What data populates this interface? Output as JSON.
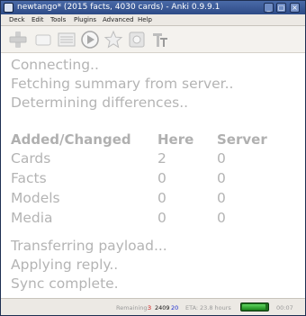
{
  "window": {
    "title": "newtango* (2015 facts, 4030 cards) - Anki 0.9.9.1",
    "minimize": "_",
    "maximize": "▢",
    "close": "×"
  },
  "menubar": {
    "items": [
      "Deck",
      "Edit",
      "Tools",
      "Plugins",
      "Advanced",
      "Help"
    ]
  },
  "toolbar": {
    "buttons": [
      "add-cards",
      "blank-card",
      "browse-list",
      "play-review",
      "star",
      "sync",
      "text-format"
    ]
  },
  "sync": {
    "lines_top": [
      "Connecting..",
      "Fetching summary from server..",
      "Determining differences.."
    ],
    "table": {
      "headers": [
        "Added/Changed",
        "Here",
        "Server"
      ],
      "rows": [
        {
          "label": "Cards",
          "here": "2",
          "server": "0"
        },
        {
          "label": "Facts",
          "here": "0",
          "server": "0"
        },
        {
          "label": "Models",
          "here": "0",
          "server": "0"
        },
        {
          "label": "Media",
          "here": "0",
          "server": "0"
        }
      ]
    },
    "lines_bottom": [
      "Transferring payload...",
      "Applying reply..",
      "Sync complete."
    ]
  },
  "statusbar": {
    "remaining_label": "Remaining:",
    "remaining_red": "3",
    "remaining_new": "2409",
    "remaining_blue": "20",
    "eta_label": "ETA:",
    "eta_value": "23.8 hours",
    "progress_fraction": 0.92,
    "timer": "00:07"
  },
  "colors": {
    "content_text": "#b4b4b4",
    "red": "#d21010",
    "blue": "#1a2ad0",
    "progress": "#2fa52f"
  }
}
